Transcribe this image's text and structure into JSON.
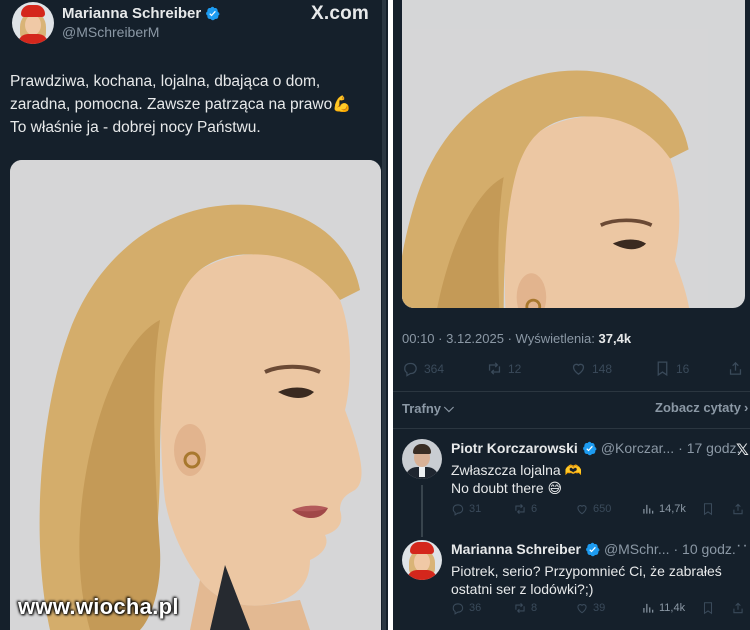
{
  "brand": "X.com",
  "watermark": "www.wiocha.pl",
  "tweet": {
    "author_name": "Marianna Schreiber",
    "author_handle": "@MSchreiberM",
    "text_lines": [
      "Prawdziwa, kochana, lojalna, dbająca o dom,",
      "zaradna, pomocna. Zawsze patrząca na prawo",
      "To właśnie ja - dobrej nocy Państwu."
    ],
    "emoji_icon": "flexed-biceps-icon",
    "time": "00:10",
    "date": "3.12.2025",
    "views_label": "Wyświetlenia:",
    "views_value": "37,4k",
    "replies": "364",
    "reposts": "12",
    "likes": "148",
    "bookmarks": "16"
  },
  "sort": {
    "filter_label": "Trafny",
    "quotes_label": "Zobacz cytaty"
  },
  "replies": [
    {
      "name": "Piotr Korczarowski",
      "handle": "@Korczar...",
      "time": "· 17 godz.",
      "lines": [
        "Zwłaszcza lojalna",
        "No doubt there"
      ],
      "line_emojis": [
        "heart-hands-icon",
        "grinning-sweat-icon"
      ],
      "replies": "31",
      "reposts": "6",
      "likes": "650",
      "views": "14,7k"
    },
    {
      "name": "Marianna Schreiber",
      "handle": "@MSchr...",
      "time": "· 10 godz.",
      "lines": [
        "Piotrek, serio? Przypomnieć Ci, że zabrałeś",
        "ostatni ser z lodówki?;)"
      ],
      "replies": "36",
      "reposts": "8",
      "likes": "39",
      "views": "11,4k"
    }
  ],
  "colors": {
    "background": "#15202b",
    "text": "#e7e9ea",
    "muted": "#8b98a5",
    "verified": "#1d9bf0"
  }
}
